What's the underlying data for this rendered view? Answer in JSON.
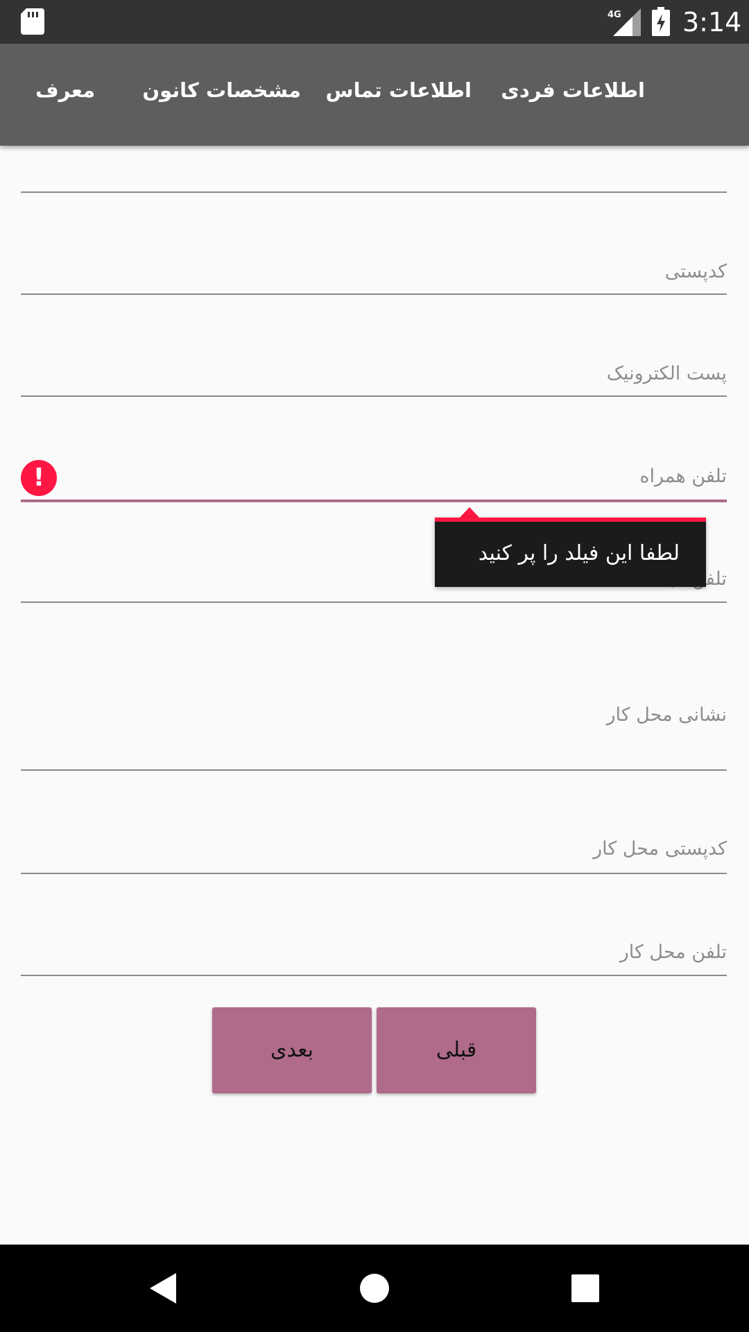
{
  "status_bar": {
    "time": "3:14",
    "network": "4G",
    "icons": [
      "sd-card-icon",
      "signal-icon",
      "battery-charging-icon"
    ]
  },
  "tabs": [
    {
      "label": "اطلاعات فردی"
    },
    {
      "label": "اطلاعات تماس"
    },
    {
      "label": "مشخصات کانون"
    },
    {
      "label": "معرف"
    }
  ],
  "form": {
    "fields": [
      {
        "hint": "کدپستی"
      },
      {
        "hint": "پست الکترونیک"
      },
      {
        "hint": "تلفن همراه"
      },
      {
        "hint": "تلفن ثابت"
      },
      {
        "hint": "نشانی محل کار"
      },
      {
        "hint": "کدپستی محل کار"
      },
      {
        "hint": "تلفن محل کار"
      }
    ],
    "error_tooltip": "لطفا این فیلد را پر کنید"
  },
  "buttons": {
    "next": "بعدی",
    "previous": "قبلی"
  },
  "colors": {
    "status_bar": "#333333",
    "tab_bar": "#5e5e5e",
    "accent": "#b06b8b",
    "error": "#ff1744",
    "background": "#fafafa"
  },
  "nav_bar": {
    "icons": [
      "back-icon",
      "home-icon",
      "recents-icon"
    ]
  }
}
